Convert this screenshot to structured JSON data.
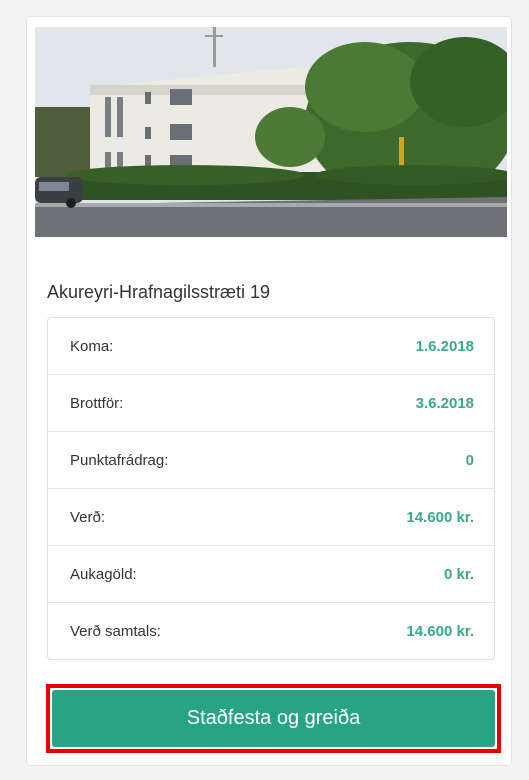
{
  "property": {
    "image_alt": "Apartment building photo",
    "title": "Akureyri-Hrafnagilsstræti 19"
  },
  "details": [
    {
      "label": "Koma:",
      "value": "1.6.2018"
    },
    {
      "label": "Brottför:",
      "value": "3.6.2018"
    },
    {
      "label": "Punktafrádrag:",
      "value": "0"
    },
    {
      "label": "Verð:",
      "value": "14.600 kr."
    },
    {
      "label": "Aukagöld:",
      "value": "0 kr."
    },
    {
      "label": "Verð samtals:",
      "value": "14.600 kr."
    }
  ],
  "actions": {
    "confirm_pay_label": "Staðfesta og greiða"
  },
  "colors": {
    "accent": "#27a385",
    "value_text": "#3aa88a",
    "highlight_border": "#e60000"
  }
}
